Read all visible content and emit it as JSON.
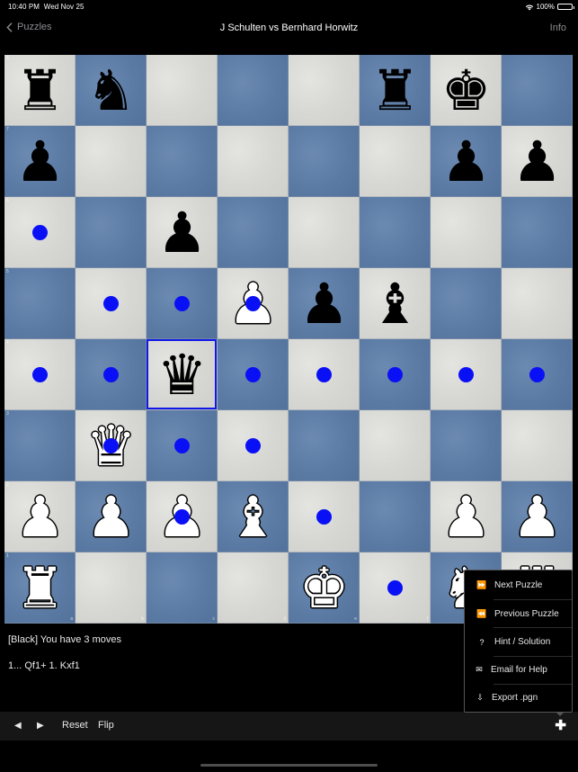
{
  "status_bar": {
    "time": "10:40 PM",
    "date": "Wed Nov 25",
    "battery_percent_label": "100%",
    "battery_level": 1.0,
    "wifi_icon": "wifi-icon"
  },
  "nav": {
    "back_label": "Puzzles",
    "title": "J Schulten vs Bernhard Horwitz",
    "info_label": "Info"
  },
  "board": {
    "files": [
      "a",
      "b",
      "c",
      "d",
      "e",
      "f",
      "g",
      "h"
    ],
    "ranks": [
      "8",
      "7",
      "6",
      "5",
      "4",
      "3",
      "2",
      "1"
    ],
    "colors": {
      "light": "#d9d9d6",
      "dark": "#5f7fa8",
      "highlight": "#0a10f5"
    },
    "selected_square": "c4",
    "pieces": {
      "a8": {
        "color": "black",
        "type": "rook",
        "glyph": "♜"
      },
      "b8": {
        "color": "black",
        "type": "knight",
        "glyph": "♞"
      },
      "f8": {
        "color": "black",
        "type": "rook",
        "glyph": "♜"
      },
      "g8": {
        "color": "black",
        "type": "king",
        "glyph": "♚"
      },
      "a7": {
        "color": "black",
        "type": "pawn",
        "glyph": "♟"
      },
      "g7": {
        "color": "black",
        "type": "pawn",
        "glyph": "♟"
      },
      "h7": {
        "color": "black",
        "type": "pawn",
        "glyph": "♟"
      },
      "c6": {
        "color": "black",
        "type": "pawn",
        "glyph": "♟"
      },
      "d5": {
        "color": "white",
        "type": "pawn",
        "glyph": "♟"
      },
      "e5": {
        "color": "black",
        "type": "pawn",
        "glyph": "♟"
      },
      "f5": {
        "color": "black",
        "type": "bishop",
        "glyph": "♝"
      },
      "c4": {
        "color": "black",
        "type": "queen",
        "glyph": "♛"
      },
      "b3": {
        "color": "white",
        "type": "queen",
        "glyph": "♛"
      },
      "a2": {
        "color": "white",
        "type": "pawn",
        "glyph": "♟"
      },
      "b2": {
        "color": "white",
        "type": "pawn",
        "glyph": "♟"
      },
      "c2": {
        "color": "white",
        "type": "pawn",
        "glyph": "♟"
      },
      "d2": {
        "color": "white",
        "type": "bishop",
        "glyph": "♝"
      },
      "g2": {
        "color": "white",
        "type": "pawn",
        "glyph": "♟"
      },
      "h2": {
        "color": "white",
        "type": "pawn",
        "glyph": "♟"
      },
      "a1": {
        "color": "white",
        "type": "rook",
        "glyph": "♜"
      },
      "e1": {
        "color": "white",
        "type": "king",
        "glyph": "♚"
      },
      "g1": {
        "color": "white",
        "type": "knight",
        "glyph": "♞"
      },
      "h1": {
        "color": "white",
        "type": "rook",
        "glyph": "♜"
      }
    },
    "legal_move_targets": [
      "a6",
      "b5",
      "c5",
      "d5",
      "a4",
      "b4",
      "d4",
      "e4",
      "f4",
      "g4",
      "h4",
      "b3",
      "c3",
      "d3",
      "c2",
      "e2",
      "f1"
    ]
  },
  "game": {
    "prompt": "[Black] You have 3 moves",
    "moves": "1... Qf1+ 1. Kxf1"
  },
  "toolbar": {
    "prev_glyph": "◀",
    "next_glyph": "▶",
    "reset_label": "Reset",
    "flip_label": "Flip",
    "add_glyph": "✚"
  },
  "menu": {
    "items": [
      {
        "label": "Next Puzzle",
        "icon": "fast-forward-icon",
        "glyph": "⏩"
      },
      {
        "label": "Previous Puzzle",
        "icon": "rewind-icon",
        "glyph": "⏪"
      },
      {
        "label": "Hint / Solution",
        "icon": "question-icon",
        "glyph": "?"
      },
      {
        "label": "Email for Help",
        "icon": "email-help-icon",
        "glyph": "✉"
      },
      {
        "label": "Export .pgn",
        "icon": "export-icon",
        "glyph": "⇩"
      }
    ]
  }
}
